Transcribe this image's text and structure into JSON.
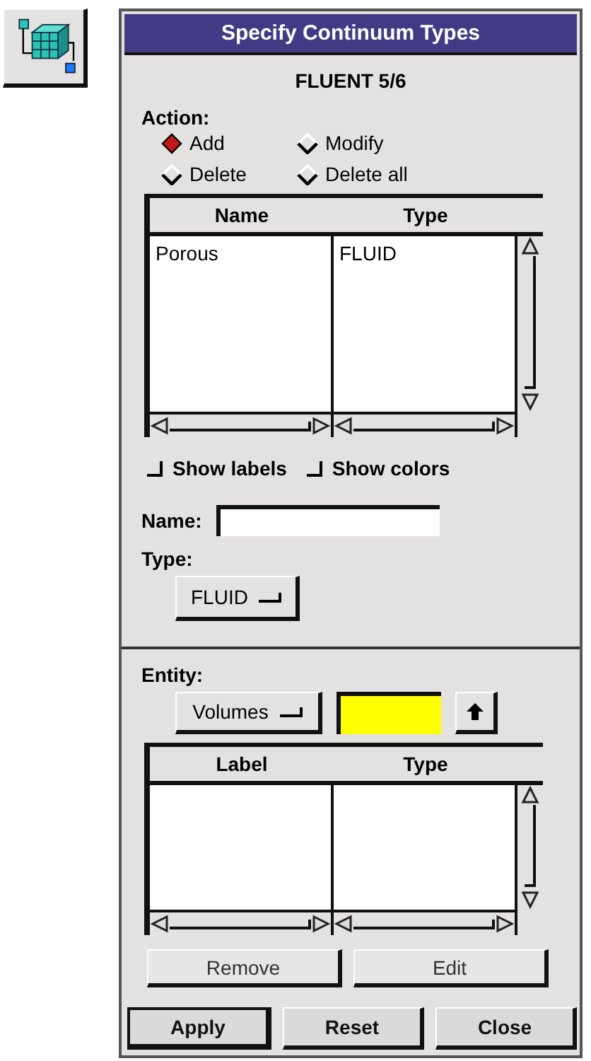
{
  "window": {
    "title": "Specify Continuum Types"
  },
  "heading": "FLUENT 5/6",
  "action": {
    "label": "Action:",
    "options": [
      {
        "label": "Add",
        "selected": true
      },
      {
        "label": "Modify",
        "selected": false
      },
      {
        "label": "Delete",
        "selected": false
      },
      {
        "label": "Delete all",
        "selected": false
      }
    ]
  },
  "continua_list": {
    "columns": [
      "Name",
      "Type"
    ],
    "rows": [
      [
        "Porous",
        "FLUID"
      ]
    ]
  },
  "toggles": [
    {
      "label": "Show labels",
      "checked": false
    },
    {
      "label": "Show colors",
      "checked": false
    }
  ],
  "name_field": {
    "label": "Name:"
  },
  "type": {
    "label": "Type:",
    "value": "FLUID"
  },
  "entity": {
    "label": "Entity:",
    "value": "Volumes"
  },
  "entity_list": {
    "columns": [
      "Label",
      "Type"
    ]
  },
  "list_buttons": [
    "Remove",
    "Edit"
  ],
  "buttons": [
    "Apply",
    "Reset",
    "Close"
  ]
}
